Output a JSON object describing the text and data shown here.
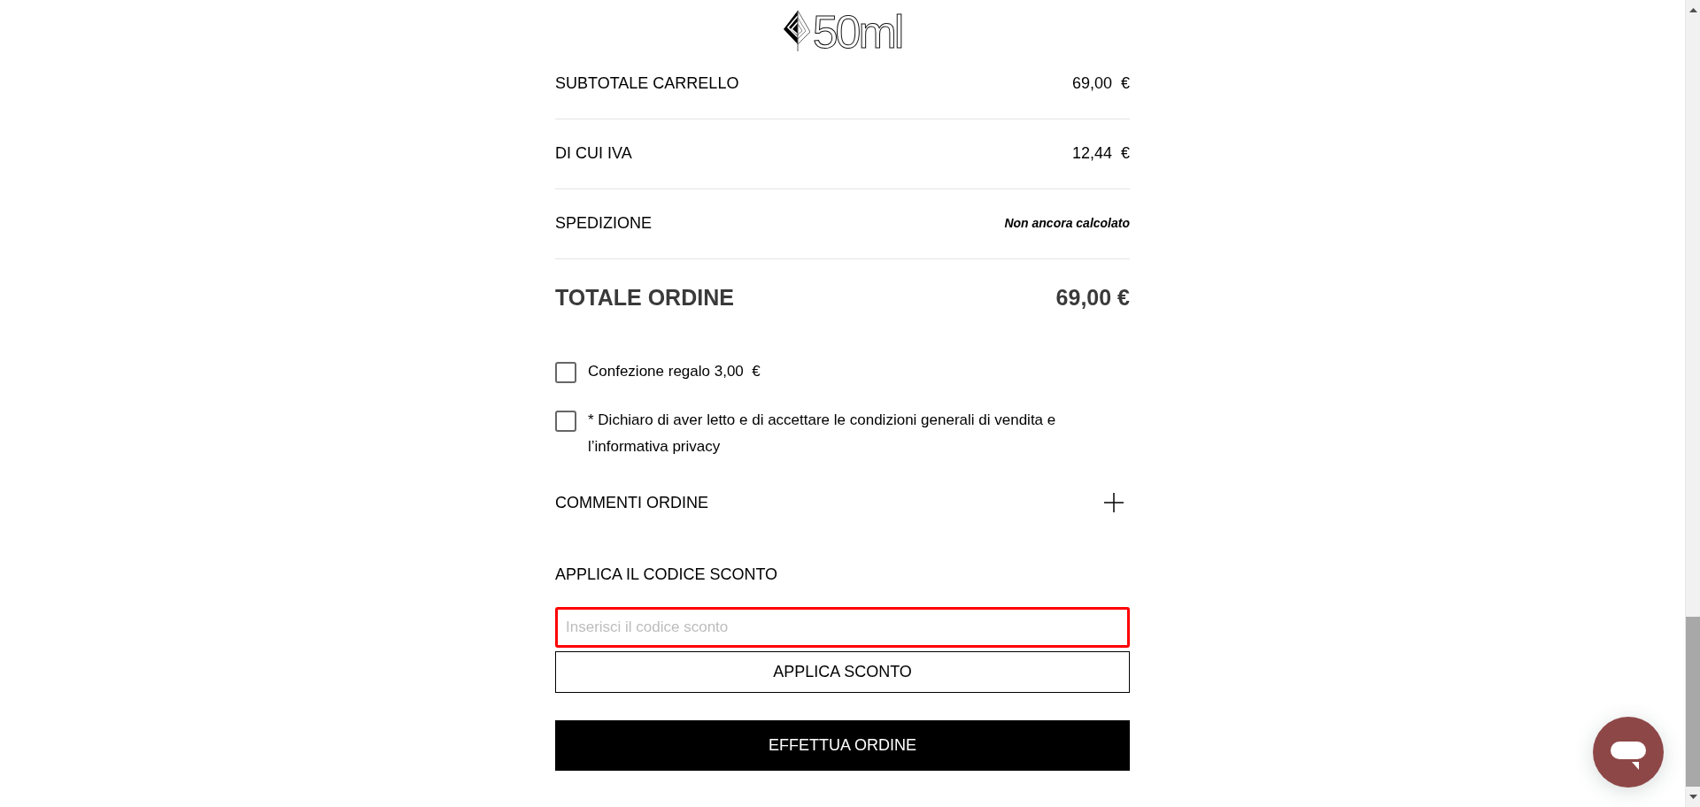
{
  "header": {
    "logo_text": "50ml"
  },
  "summary": {
    "rows": [
      {
        "label": "SUBTOTALE CARRELLO",
        "value": "69,00  €",
        "kind": "amount"
      },
      {
        "label": "DI CUI IVA",
        "value": "12,44  €",
        "kind": "amount"
      },
      {
        "label": "SPEDIZIONE",
        "value": "Non ancora calcolato",
        "kind": "note"
      }
    ],
    "total": {
      "label": "TOTALE ORDINE",
      "value": "69,00 €"
    }
  },
  "options": [
    {
      "label": "Confezione regalo 3,00  €",
      "checked": false
    },
    {
      "label": "* Dichiaro di aver letto e di accettare le condizioni generali di vendita e l’informativa privacy",
      "checked": false
    }
  ],
  "comments": {
    "label": "COMMENTI ORDINE",
    "expanded": false
  },
  "discount": {
    "heading": "APPLICA IL CODICE SCONTO",
    "placeholder": "Inserisci il codice sconto",
    "error": true,
    "button": "APPLICA SCONTO"
  },
  "place_order_button": "EFFETTUA ORDINE"
}
